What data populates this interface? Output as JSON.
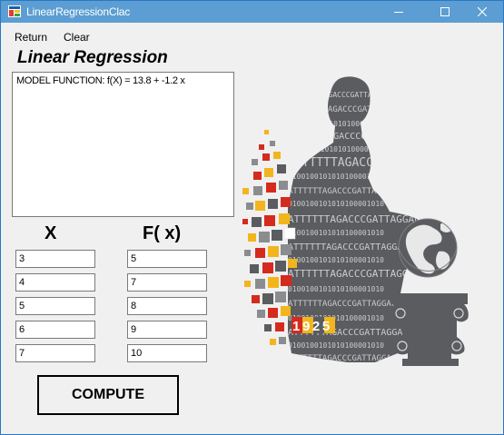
{
  "window": {
    "title": "LinearRegressionClac"
  },
  "menu": {
    "items": [
      "Return",
      "Clear"
    ]
  },
  "heading": "Linear Regression",
  "output": {
    "text": "MODEL FUNCTION: f(X) = 13.8 + -1.2 x"
  },
  "columns": {
    "x_label": "X",
    "fx_label": "F( x)"
  },
  "x_values": [
    "3",
    "4",
    "5",
    "6",
    "7"
  ],
  "fx_values": [
    "5",
    "7",
    "8",
    "9",
    "10"
  ],
  "compute_label": "COMPUTE",
  "art": {
    "year": "1925",
    "dna_text": "ATTTTTTAGACCCGATTAGGACCTAGGATTATTTTAA",
    "binary_text": "0100100101010100001010",
    "colors": {
      "accent_red": "#d42b1e",
      "accent_yellow": "#f2b51c",
      "silhouette": "#5a5c60",
      "pixel_gray": "#8a8c90"
    }
  }
}
